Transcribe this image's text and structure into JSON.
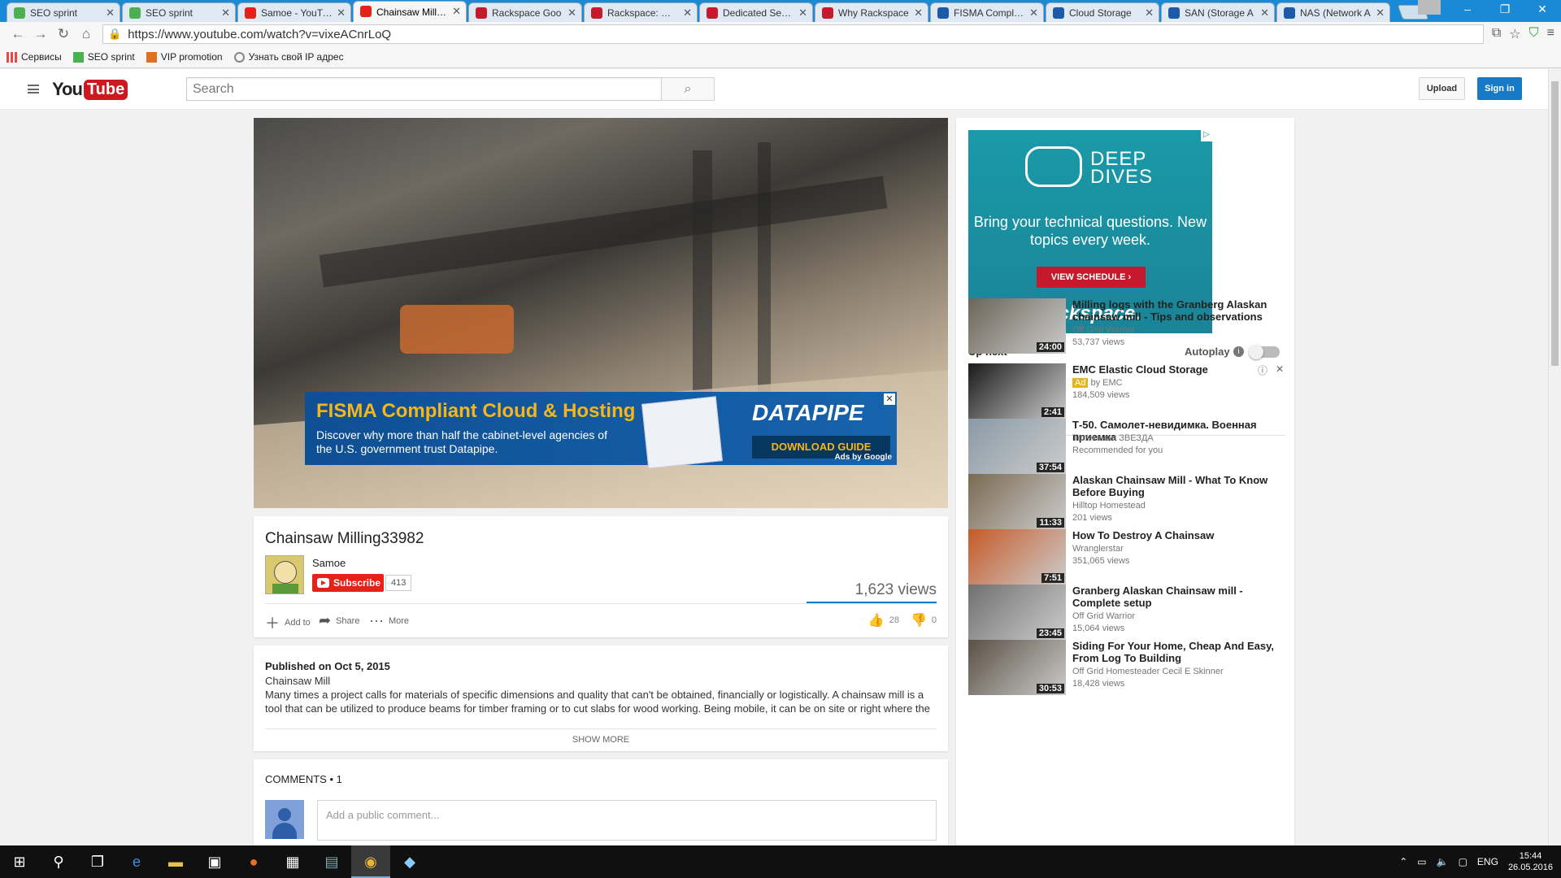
{
  "browser": {
    "tabs": [
      {
        "title": "SEO sprint",
        "color": "#4caf50"
      },
      {
        "title": "SEO sprint",
        "color": "#4caf50"
      },
      {
        "title": "Samoe - YouTube",
        "color": "#e62117"
      },
      {
        "title": "Chainsaw Milling",
        "color": "#e62117",
        "active": true
      },
      {
        "title": "Rackspace Goo",
        "color": "#c41a2b"
      },
      {
        "title": "Rackspace: Man",
        "color": "#c41a2b"
      },
      {
        "title": "Dedicated Serve",
        "color": "#c41a2b"
      },
      {
        "title": "Why Rackspace",
        "color": "#c41a2b"
      },
      {
        "title": "FISMA Complian",
        "color": "#1a5aa8"
      },
      {
        "title": "Cloud Storage",
        "color": "#1a5aa8"
      },
      {
        "title": "SAN (Storage A",
        "color": "#1a5aa8"
      },
      {
        "title": "NAS (Network A",
        "color": "#1a5aa8"
      }
    ],
    "url": "https://www.youtube.com/watch?v=vixeACnrLoQ",
    "bookmarks": [
      "Сервисы",
      "SEO sprint",
      "VIP promotion",
      "Узнать свой IP адрес"
    ]
  },
  "header": {
    "logo_you": "You",
    "logo_tube": "Tube",
    "search_placeholder": "Search",
    "upload_label": "Upload",
    "signin_label": "Sign in"
  },
  "player_ad": {
    "headline": "FISMA Compliant Cloud & Hosting",
    "body": "Discover why more than half the cabinet-level agencies of the U.S. government trust Datapipe.",
    "brand": "DATAPIPE",
    "cta": "DOWNLOAD GUIDE",
    "by": "Ads by Google"
  },
  "video": {
    "title": "Chainsaw Milling33982",
    "channel": "Samoe",
    "subscribe_label": "Subscribe",
    "subscriber_count": "413",
    "views": "1,623 views",
    "actions": {
      "add_to": "Add to",
      "share": "Share",
      "more": "More"
    },
    "likes": "28",
    "dislikes": "0"
  },
  "description": {
    "published": "Published on Oct 5, 2015",
    "text": "Chainsaw Mill\nMany times a project calls for materials of specific dimensions and quality that can't be obtained, financially or logistically. A chainsaw mill is a tool that can be utilized to produce beams for timber framing or to cut slabs for wood working. Being mobile, it can be on site or right where the",
    "show_more": "SHOW MORE"
  },
  "comments": {
    "header": "COMMENTS • 1",
    "placeholder": "Add a public comment..."
  },
  "sidebar_ad": {
    "title": "DEEP DIVES",
    "body": "Bring your technical questions. New topics every week.",
    "cta": "VIEW SCHEDULE ›",
    "brand": "rackspace."
  },
  "upnext": {
    "label": "Up next",
    "autoplay_label": "Autoplay",
    "videos": [
      {
        "title": "Milling logs with the Granberg Alaskan chainsaw mill - Tips and observations",
        "channel": "Off Grid Warrior",
        "views": "53,737 views",
        "duration": "24:00",
        "thumb": "#6b6558"
      },
      {
        "title": "EMC Elastic Cloud Storage",
        "ad_badge": "Ad",
        "channel": "by EMC",
        "views": "184,509 views",
        "duration": "2:41",
        "thumb": "#1a1a1a"
      },
      {
        "title": "Т-50. Самолет-невидимка. Военная приемка",
        "channel": "Телеканал ЗВЕЗДА",
        "views": "Recommended for you",
        "duration": "37:54",
        "thumb": "#8a9aa6"
      },
      {
        "title": "Alaskan Chainsaw Mill - What To Know Before Buying",
        "channel": "Hilltop Homestead",
        "views": "201 views",
        "duration": "11:33",
        "thumb": "#7a6a52"
      },
      {
        "title": "How To Destroy A Chainsaw",
        "channel": "Wranglerstar",
        "views": "351,065 views",
        "duration": "7:51",
        "thumb": "#c65a28"
      },
      {
        "title": "Granberg Alaskan Chainsaw mill - Complete setup",
        "channel": "Off Grid Warrior",
        "views": "15,064 views",
        "duration": "23:45",
        "thumb": "#707070"
      },
      {
        "title": "Siding For Your Home, Cheap And Easy, From Log To Building",
        "channel": "Off Grid Homesteader Cecil E Skinner",
        "views": "18,428 views",
        "duration": "30:53",
        "thumb": "#5a5044"
      }
    ]
  },
  "taskbar": {
    "lang": "ENG",
    "time": "15:44",
    "date": "26.05.2016"
  }
}
